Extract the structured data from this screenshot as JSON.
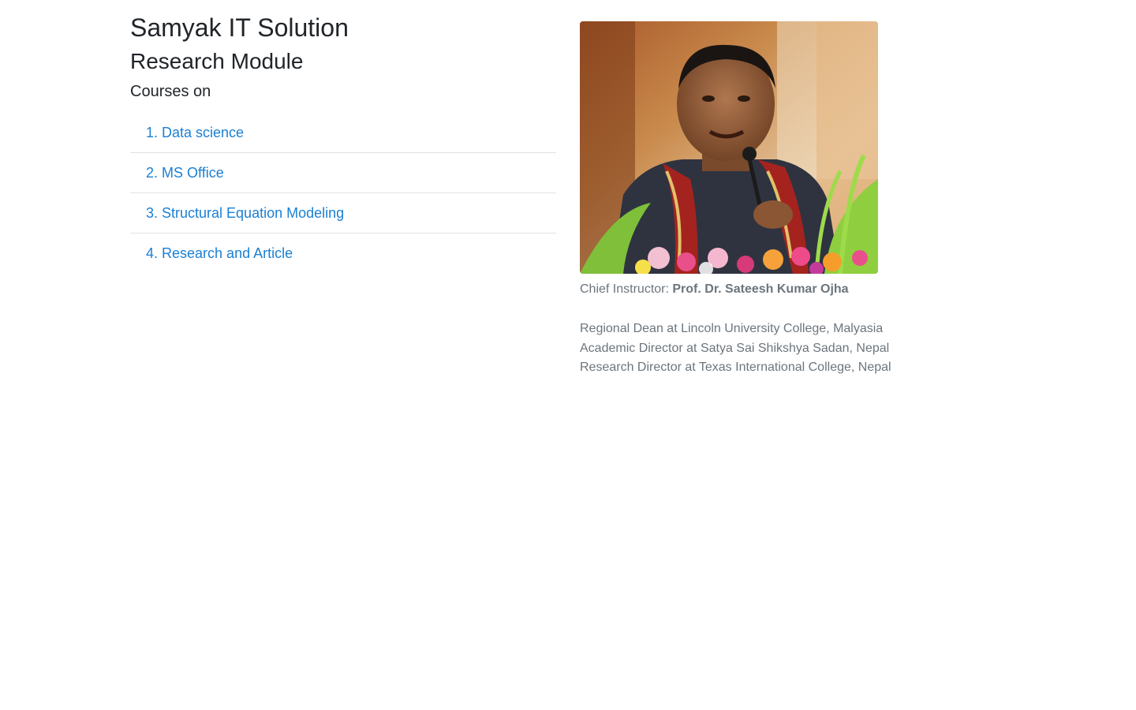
{
  "header": {
    "site_title": "Samyak IT Solution",
    "module_title": "Research Module",
    "courses_heading": "Courses on"
  },
  "courses": [
    {
      "number": "1.",
      "label": "Data science"
    },
    {
      "number": "2.",
      "label": "MS Office"
    },
    {
      "number": "3.",
      "label": "Structural Equation Modeling"
    },
    {
      "number": "4.",
      "label": "Research and Article"
    }
  ],
  "instructor": {
    "caption_prefix": "Chief Instructor:",
    "name": "Prof. Dr. Sateesh Kumar Ojha",
    "roles": [
      "Regional Dean at Lincoln University College, Malyasia",
      "Academic Director at Satya Sai Shikshya Sadan, Nepal",
      "Research Director at Texas International College, Nepal"
    ]
  },
  "colors": {
    "link": "#1a7fd4",
    "muted_text": "#6c757d",
    "heading_text": "#212529",
    "divider": "#dee2e6"
  }
}
